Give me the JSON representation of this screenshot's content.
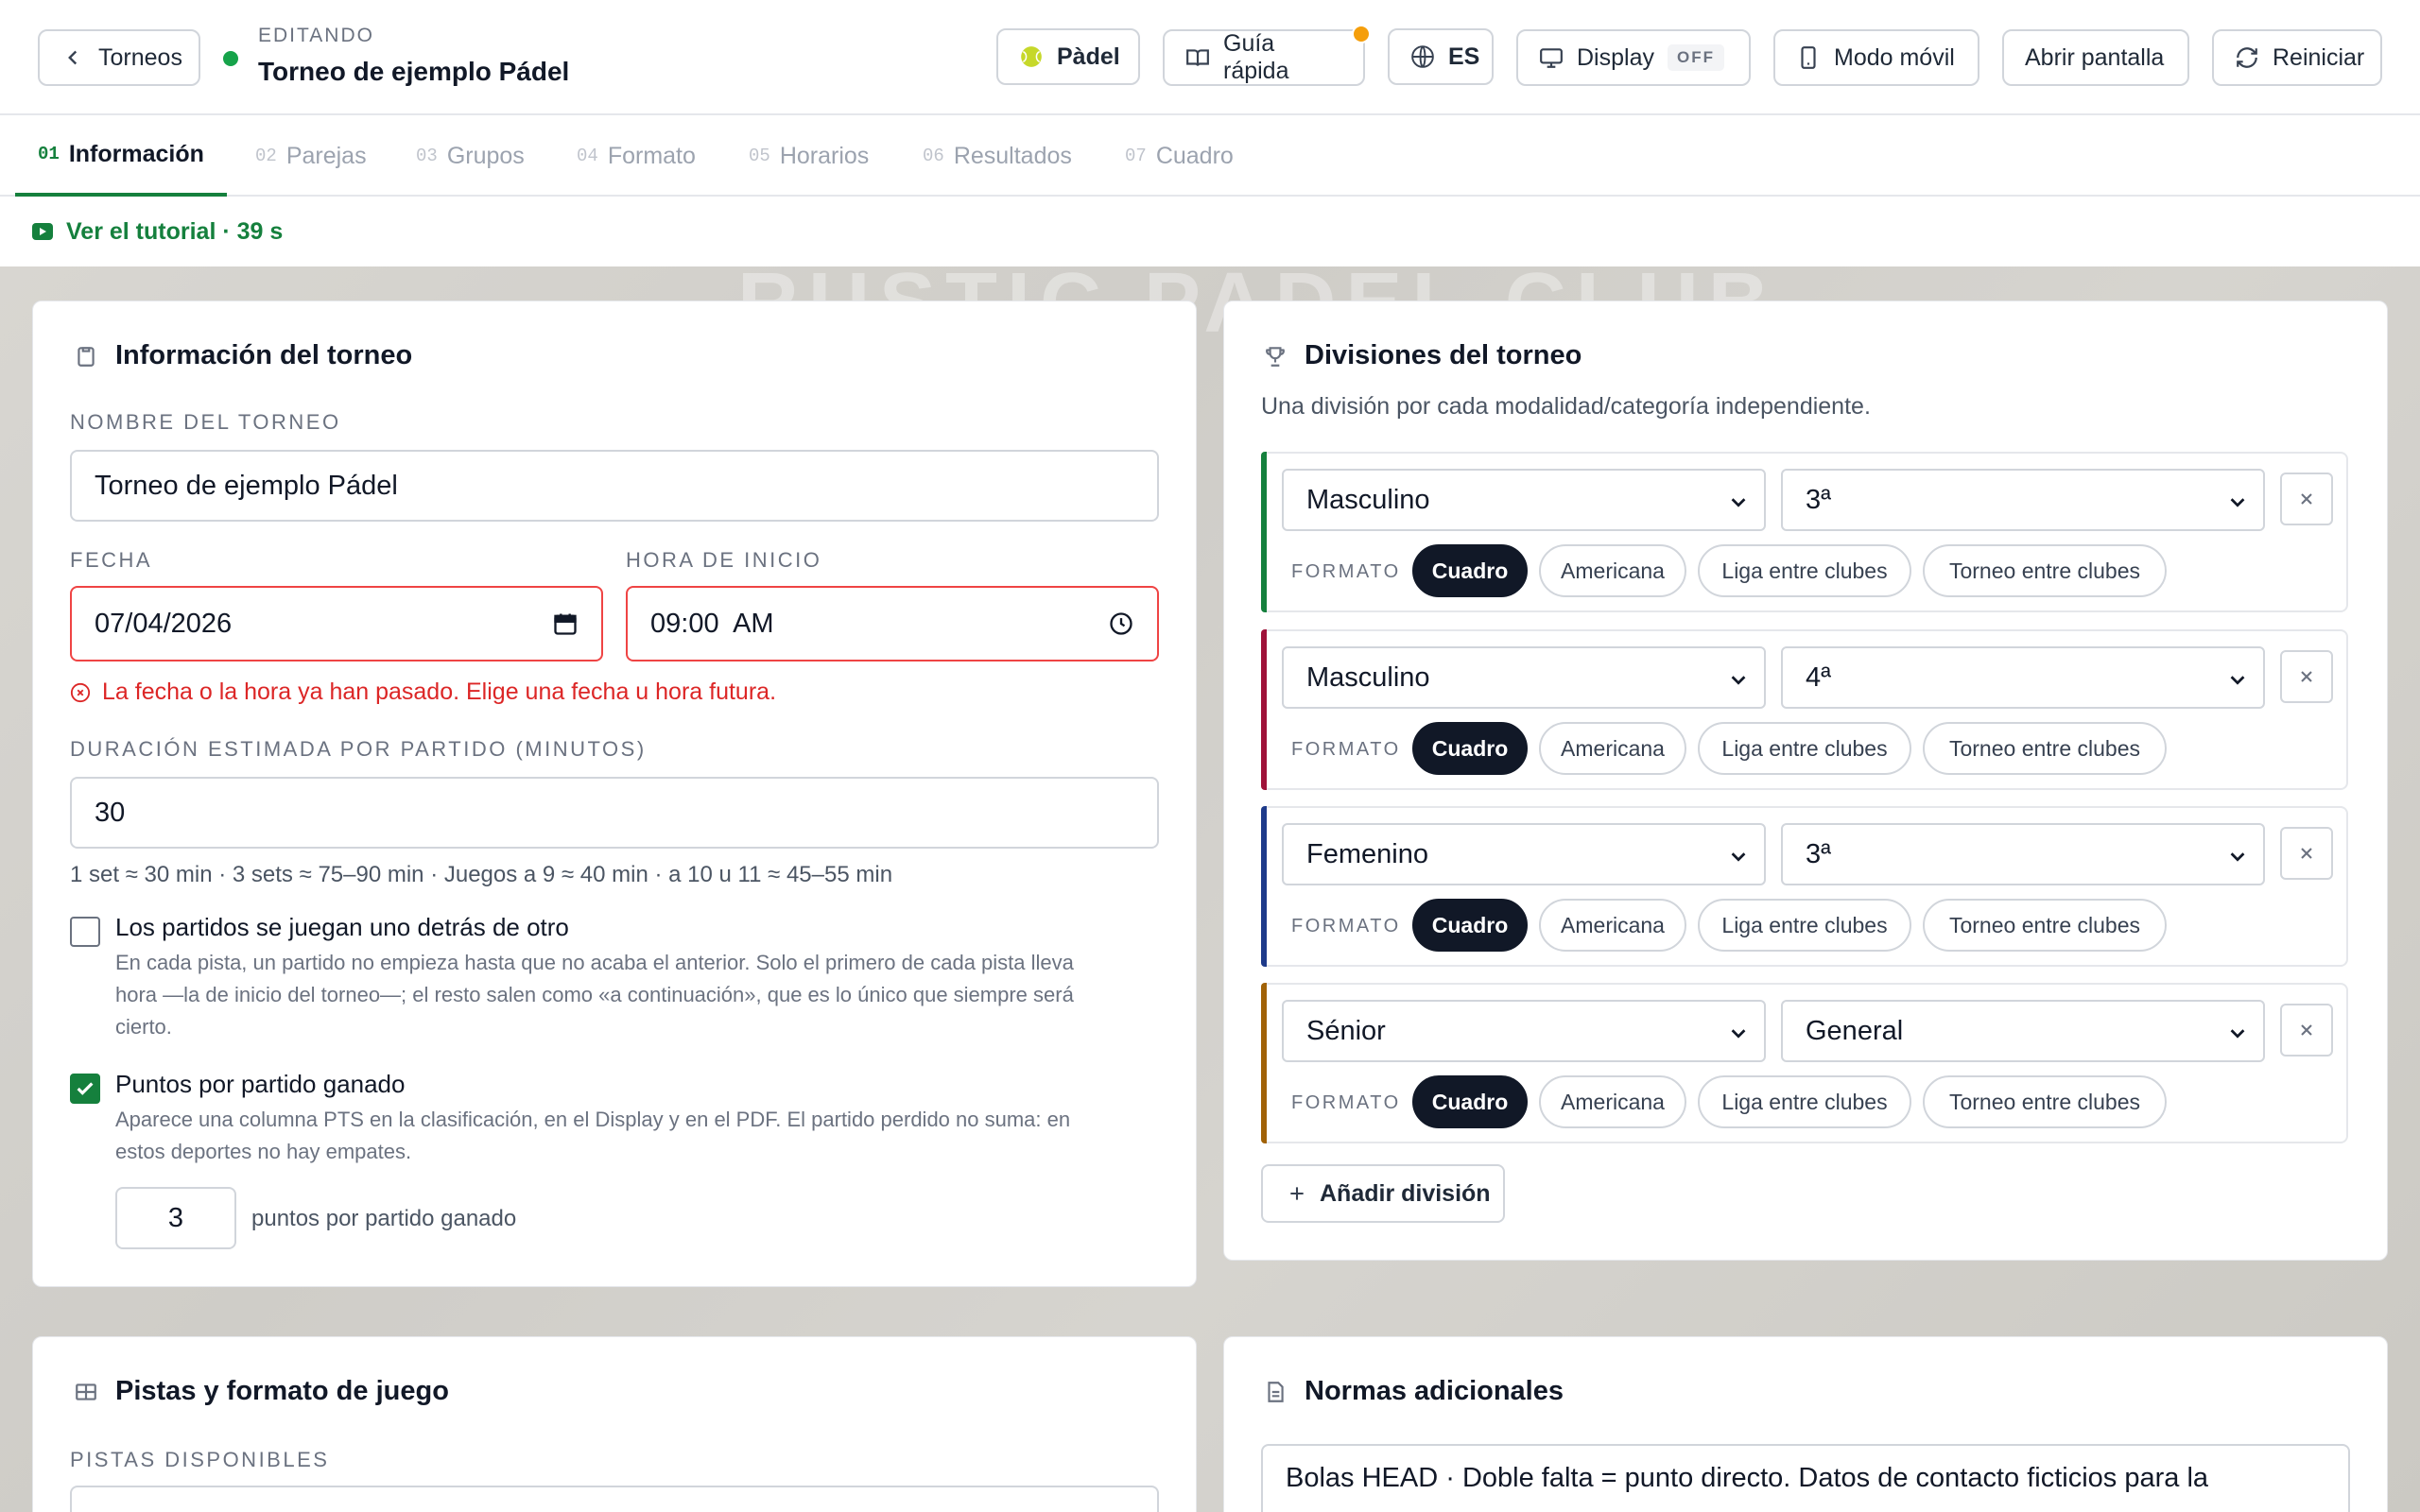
{
  "header": {
    "back_label": "Torneos",
    "editing_label": "EDITANDO",
    "title": "Torneo de ejemplo Pádel",
    "sport_label": "Pàdel",
    "guide_label": "Guía rápida",
    "lang_label": "ES",
    "display_label": "Display",
    "display_state": "OFF",
    "mobile_label": "Modo móvil",
    "open_screen_label": "Abrir pantalla",
    "reset_label": "Reiniciar"
  },
  "tabs": [
    {
      "num": "01",
      "label": "Información"
    },
    {
      "num": "02",
      "label": "Parejas"
    },
    {
      "num": "03",
      "label": "Grupos"
    },
    {
      "num": "04",
      "label": "Formato"
    },
    {
      "num": "05",
      "label": "Horarios"
    },
    {
      "num": "06",
      "label": "Resultados"
    },
    {
      "num": "07",
      "label": "Cuadro"
    }
  ],
  "tutorial": {
    "label": "Ver el tutorial · 39 s"
  },
  "info": {
    "title": "Información del torneo",
    "name_label": "NOMBRE DEL TORNEO",
    "name_value": "Torneo de ejemplo Pádel",
    "date_label": "FECHA",
    "date_value": "07/04/2026",
    "time_label": "HORA DE INICIO",
    "time_value": "09:00  AM",
    "error": "La fecha o la hora ya han pasado. Elige una fecha u hora futura.",
    "duration_label": "DURACIÓN ESTIMADA POR PARTIDO (MINUTOS)",
    "duration_value": "30",
    "duration_hint": "1 set ≈ 30 min · 3 sets ≈ 75–90 min · Juegos a 9 ≈ 40 min · a 10 u 11 ≈ 45–55 min",
    "sequential": {
      "title": "Los partidos se juegan uno detrás de otro",
      "desc1": "En cada pista, un partido no empieza hasta que no acaba el anterior. Solo el primero de cada pista lleva",
      "desc2": "hora —la de inicio del torneo—; el resto salen como «a continuación», que es lo único que siempre será",
      "desc3": "cierto."
    },
    "points": {
      "title": "Puntos por partido ganado",
      "desc1": "Aparece una columna PTS en la clasificación, en el Display y en el PDF. El partido perdido no suma: en",
      "desc2": "estos deportes no hay empates.",
      "value": "3",
      "suffix": "puntos por partido ganado"
    }
  },
  "divisions": {
    "title": "Divisiones del torneo",
    "subtitle": "Una división por cada modalidad/categoría independiente.",
    "format_label": "FORMATO",
    "formats": [
      "Cuadro",
      "Americana",
      "Liga entre clubes",
      "Torneo entre clubes"
    ],
    "items": [
      {
        "gender": "Masculino",
        "category": "3ª",
        "color": "#15803d"
      },
      {
        "gender": "Masculino",
        "category": "4ª",
        "color": "#9f1239"
      },
      {
        "gender": "Femenino",
        "category": "3ª",
        "color": "#1e3a8a"
      },
      {
        "gender": "Sénior",
        "category": "General",
        "color": "#a16207"
      }
    ],
    "add_label": "Añadir división"
  },
  "courts": {
    "title": "Pistas y formato de juego",
    "label": "PISTAS DISPONIBLES"
  },
  "rules": {
    "title": "Normas adicionales",
    "text": "Bolas HEAD · Doble falta = punto directo. Datos de contacto ficticios para la"
  }
}
